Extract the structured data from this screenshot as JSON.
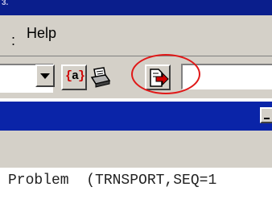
{
  "titlebar": {
    "fragment": "3."
  },
  "menubar": {
    "separator": ":",
    "help_label": "Help"
  },
  "toolbar": {
    "brace_left": "{",
    "brace_letter": "a",
    "brace_right": "}",
    "icons": [
      "dropdown-arrow-icon",
      "variable-braces-icon",
      "print-icon",
      "export-document-arrow-icon"
    ]
  },
  "content": {
    "problem_text": "Problem  (TRNSPORT,SEQ=1"
  },
  "colors": {
    "titlebar": "#0a1e8c",
    "highlight_circle": "#e01818",
    "arrow": "#d00000"
  }
}
